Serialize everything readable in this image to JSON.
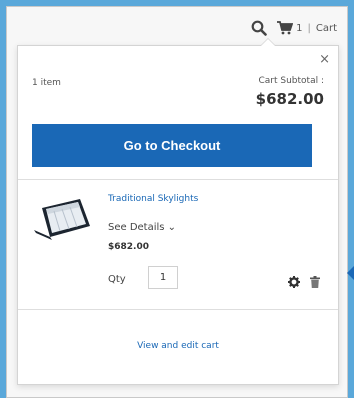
{
  "header": {
    "cart_count": "1",
    "cart_separator": "|",
    "cart_label": "Cart"
  },
  "minicart": {
    "close_symbol": "×",
    "item_count": "1 item",
    "subtotal_label": "Cart Subtotal :",
    "subtotal_value": "$682.00",
    "checkout_label": "Go to Checkout",
    "item": {
      "name": "Traditional Skylights",
      "details_label": "See Details ⌄",
      "price": "$682.00",
      "qty_label": "Qty",
      "qty_value": "1"
    },
    "view_cart_label": "View and edit cart"
  },
  "colors": {
    "background": "#5aa8da",
    "accent": "#1a68b6"
  },
  "icons": [
    "search-icon",
    "cart-icon",
    "close-icon",
    "gear-icon",
    "trash-icon"
  ]
}
